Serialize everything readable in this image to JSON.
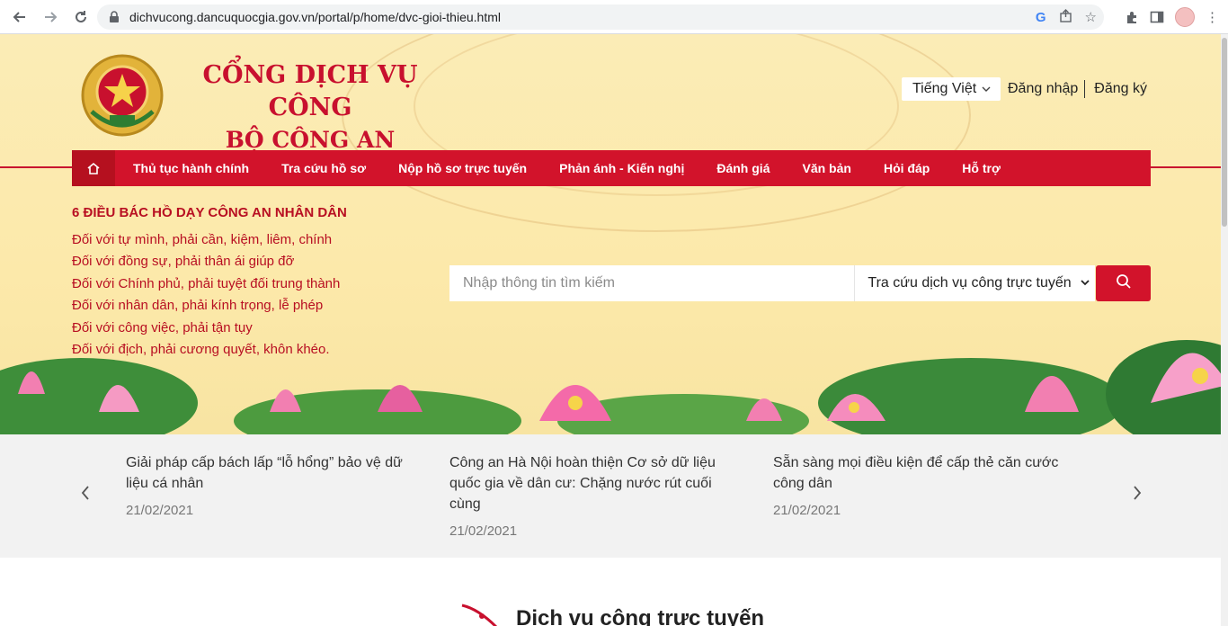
{
  "browser": {
    "url": "dichvucong.dancuquocgia.gov.vn/portal/p/home/dvc-gioi-thieu.html"
  },
  "header": {
    "title_line1": "CỔNG DỊCH VỤ CÔNG",
    "title_line2": "BỘ CÔNG AN",
    "language": "Tiếng Việt",
    "login": "Đăng nhập",
    "register": "Đăng ký"
  },
  "nav": {
    "items": [
      "Thủ tục hành chính",
      "Tra cứu hồ sơ",
      "Nộp hồ sơ trực tuyến",
      "Phản ánh - Kiến nghị",
      "Đánh giá",
      "Văn bản",
      "Hỏi đáp",
      "Hỗ trợ"
    ]
  },
  "teachings": {
    "heading": "6 ĐIỀU BÁC HỒ DẠY CÔNG AN NHÂN DÂN",
    "lines": [
      "Đối với tự mình, phải cần, kiệm, liêm, chính",
      "Đối với đồng sự, phải thân ái giúp đỡ",
      "Đối với Chính phủ, phải tuyệt đối trung thành",
      "Đối với nhân dân, phải kính trọng, lễ phép",
      "Đối với công việc, phải tận tụy",
      "Đối với địch, phải cương quyết, khôn khéo."
    ]
  },
  "search": {
    "placeholder": "Nhập thông tin tìm kiếm",
    "selected_option": "Tra cứu dịch vụ công trực tuyến"
  },
  "news": [
    {
      "title": "Giải pháp cấp bách lấp “lỗ hổng” bảo vệ dữ liệu cá nhân",
      "date": "21/02/2021"
    },
    {
      "title": "Công an Hà Nội hoàn thiện Cơ sở dữ liệu quốc gia về dân cư: Chặng nước rút cuối cùng",
      "date": "21/02/2021"
    },
    {
      "title": "Sẵn sàng mọi điều kiện để cấp thẻ căn cước công dân",
      "date": "21/02/2021"
    }
  ],
  "services": {
    "title": "Dịch vụ công trực tuyến"
  },
  "colors": {
    "brand_red": "#d2132b",
    "banner_bg": "#fbecb6",
    "news_bg": "#f2f2f2"
  }
}
